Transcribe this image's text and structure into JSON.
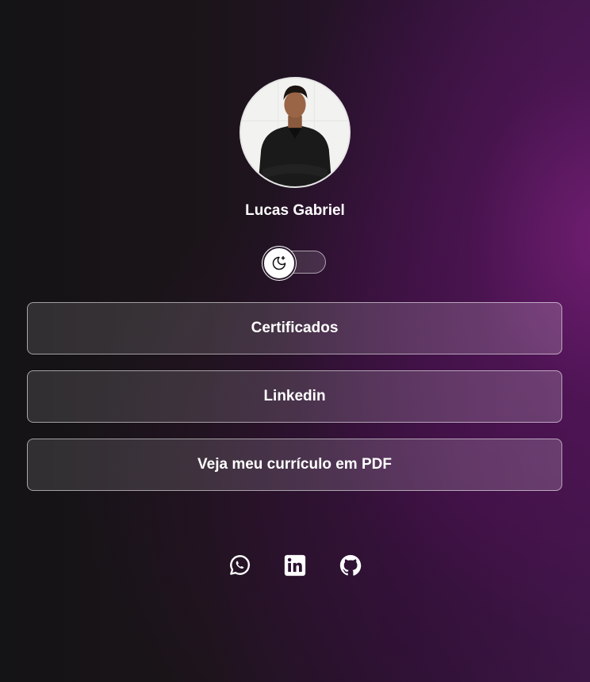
{
  "profile": {
    "name": "Lucas Gabriel",
    "avatar_icon": "profile-photo"
  },
  "theme_toggle": {
    "icon": "moon-stars-icon",
    "state": "dark"
  },
  "links": [
    {
      "label": "Certificados"
    },
    {
      "label": "Linkedin"
    },
    {
      "label": "Veja meu currículo em PDF"
    }
  ],
  "socials": [
    {
      "icon": "whatsapp-icon"
    },
    {
      "icon": "linkedin-icon"
    },
    {
      "icon": "github-icon"
    }
  ],
  "colors": {
    "background_dark": "#141316",
    "background_accent": "#5a1a60",
    "text": "#ffffff"
  }
}
